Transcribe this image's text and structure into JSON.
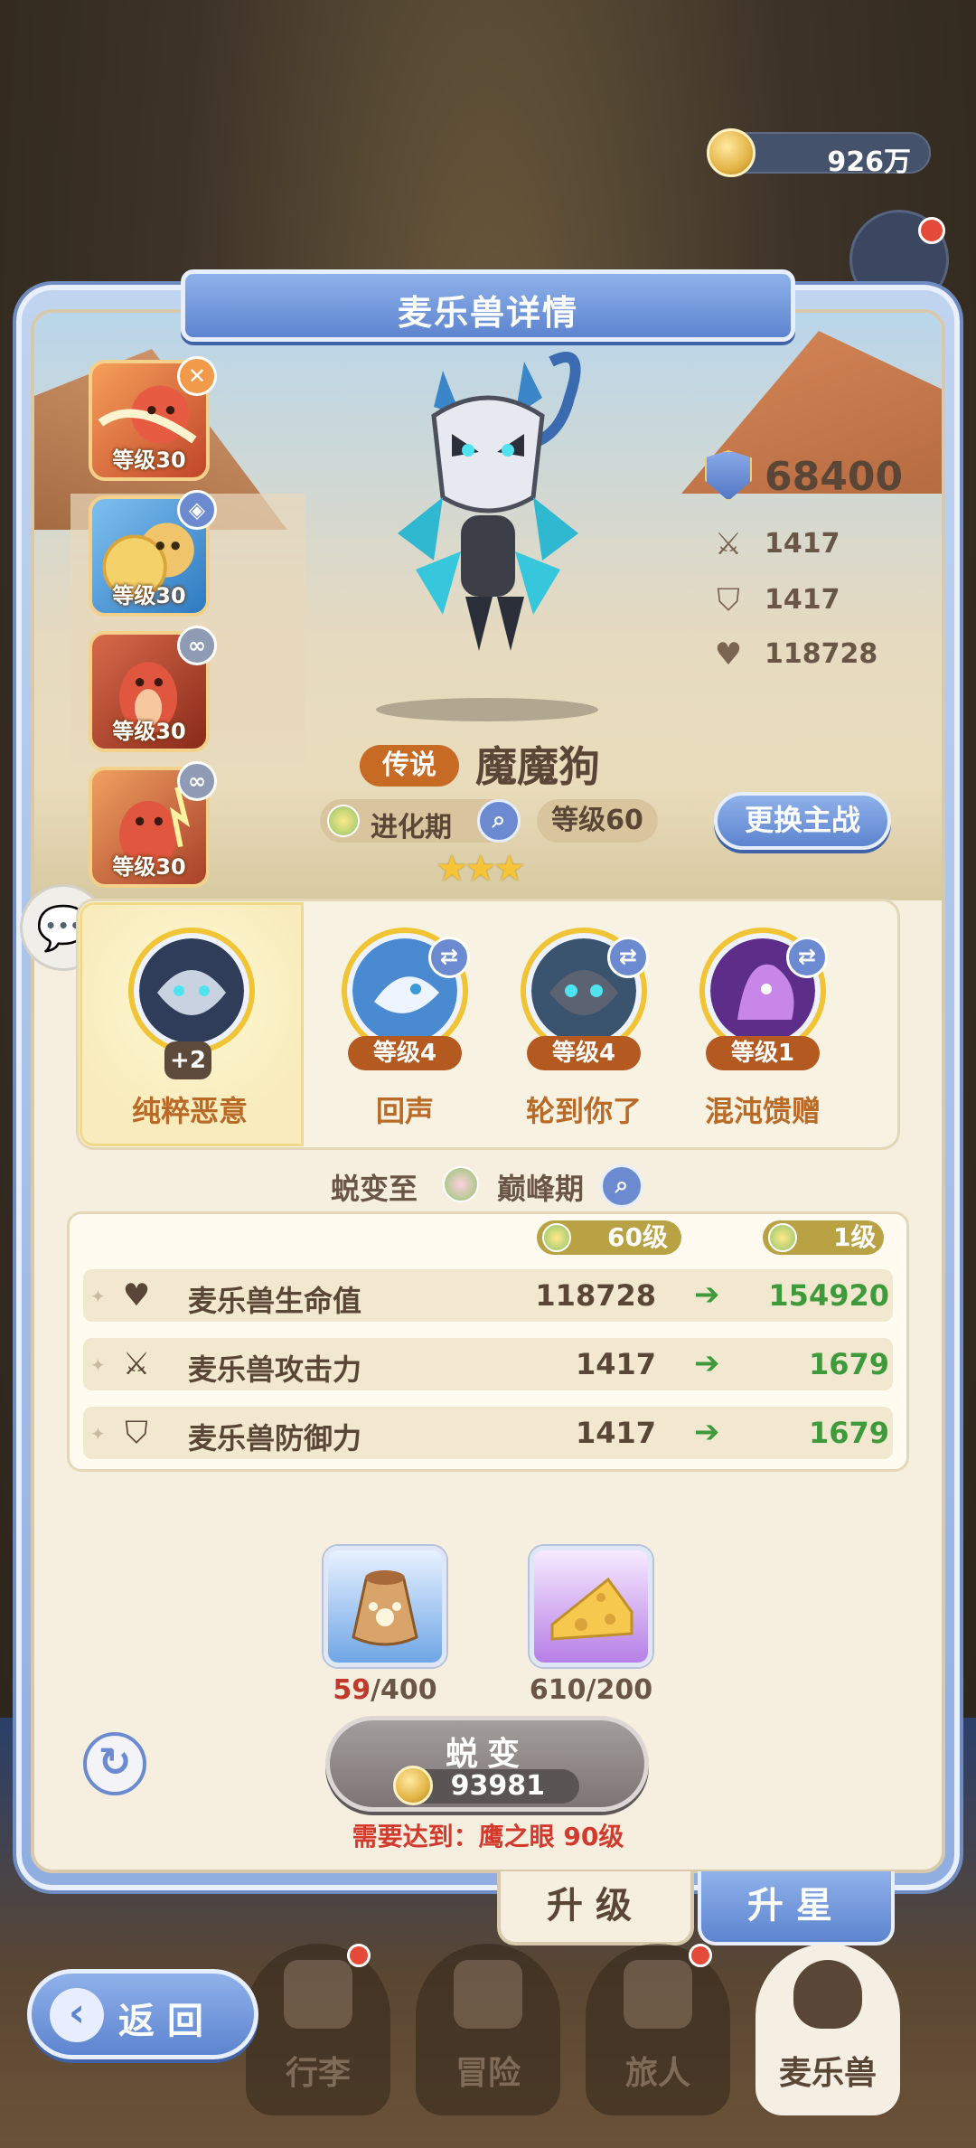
{
  "currency": {
    "amount": "926万",
    "icon": "coin-icon"
  },
  "panel": {
    "title": "麦乐兽详情"
  },
  "team": [
    {
      "level": "等级30",
      "badge": "close-icon",
      "badge_glyph": "✕",
      "badge_color": "#f19a4a"
    },
    {
      "level": "等级30",
      "badge": "shield-icon",
      "badge_glyph": "◈",
      "badge_color": "#6b8ad0"
    },
    {
      "level": "等级30",
      "badge": "link-icon",
      "badge_glyph": "∞",
      "badge_color": "#8f9bb5"
    },
    {
      "level": "等级30",
      "badge": "link-icon",
      "badge_glyph": "∞",
      "badge_color": "#8f9bb5"
    }
  ],
  "stats": {
    "power": "68400",
    "attack": "1417",
    "defense": "1417",
    "hp": "118728"
  },
  "monster": {
    "rarity": "传说",
    "name": "魔魔狗",
    "stage": "进化期",
    "level": "等级60",
    "switch_label": "更换主战",
    "stars": "★★★"
  },
  "skills": [
    {
      "name": "纯粹恶意",
      "bonus": "+2",
      "selected": true
    },
    {
      "name": "回声",
      "level": "等级4"
    },
    {
      "name": "轮到你了",
      "level": "等级4"
    },
    {
      "name": "混沌馈赠",
      "level": "等级1"
    }
  ],
  "evolve": {
    "label": "蜕变至",
    "target": "巅峰期",
    "from_level": "60级",
    "to_level": "1级",
    "rows": [
      {
        "label": "麦乐兽生命值",
        "icon": "heart-icon",
        "old": "118728",
        "new": "154920"
      },
      {
        "label": "麦乐兽攻击力",
        "icon": "swords-icon",
        "old": "1417",
        "new": "1679"
      },
      {
        "label": "麦乐兽防御力",
        "icon": "shield-icon",
        "old": "1417",
        "new": "1679"
      }
    ],
    "arrow": "➔"
  },
  "materials": [
    {
      "icon": "food-bag-icon",
      "have": "59",
      "need": "/400"
    },
    {
      "icon": "cheese-icon",
      "have": "610",
      "need": "/200"
    }
  ],
  "action": {
    "evolve_label": "蜕变",
    "cost": "93981",
    "requirement": "需要达到：鹰之眼 90级"
  },
  "tabs": {
    "upgrade": "升级",
    "upstar": "升星"
  },
  "nav": {
    "back": "返回",
    "items": [
      "行李",
      "冒险",
      "旅人",
      "麦乐兽"
    ]
  }
}
